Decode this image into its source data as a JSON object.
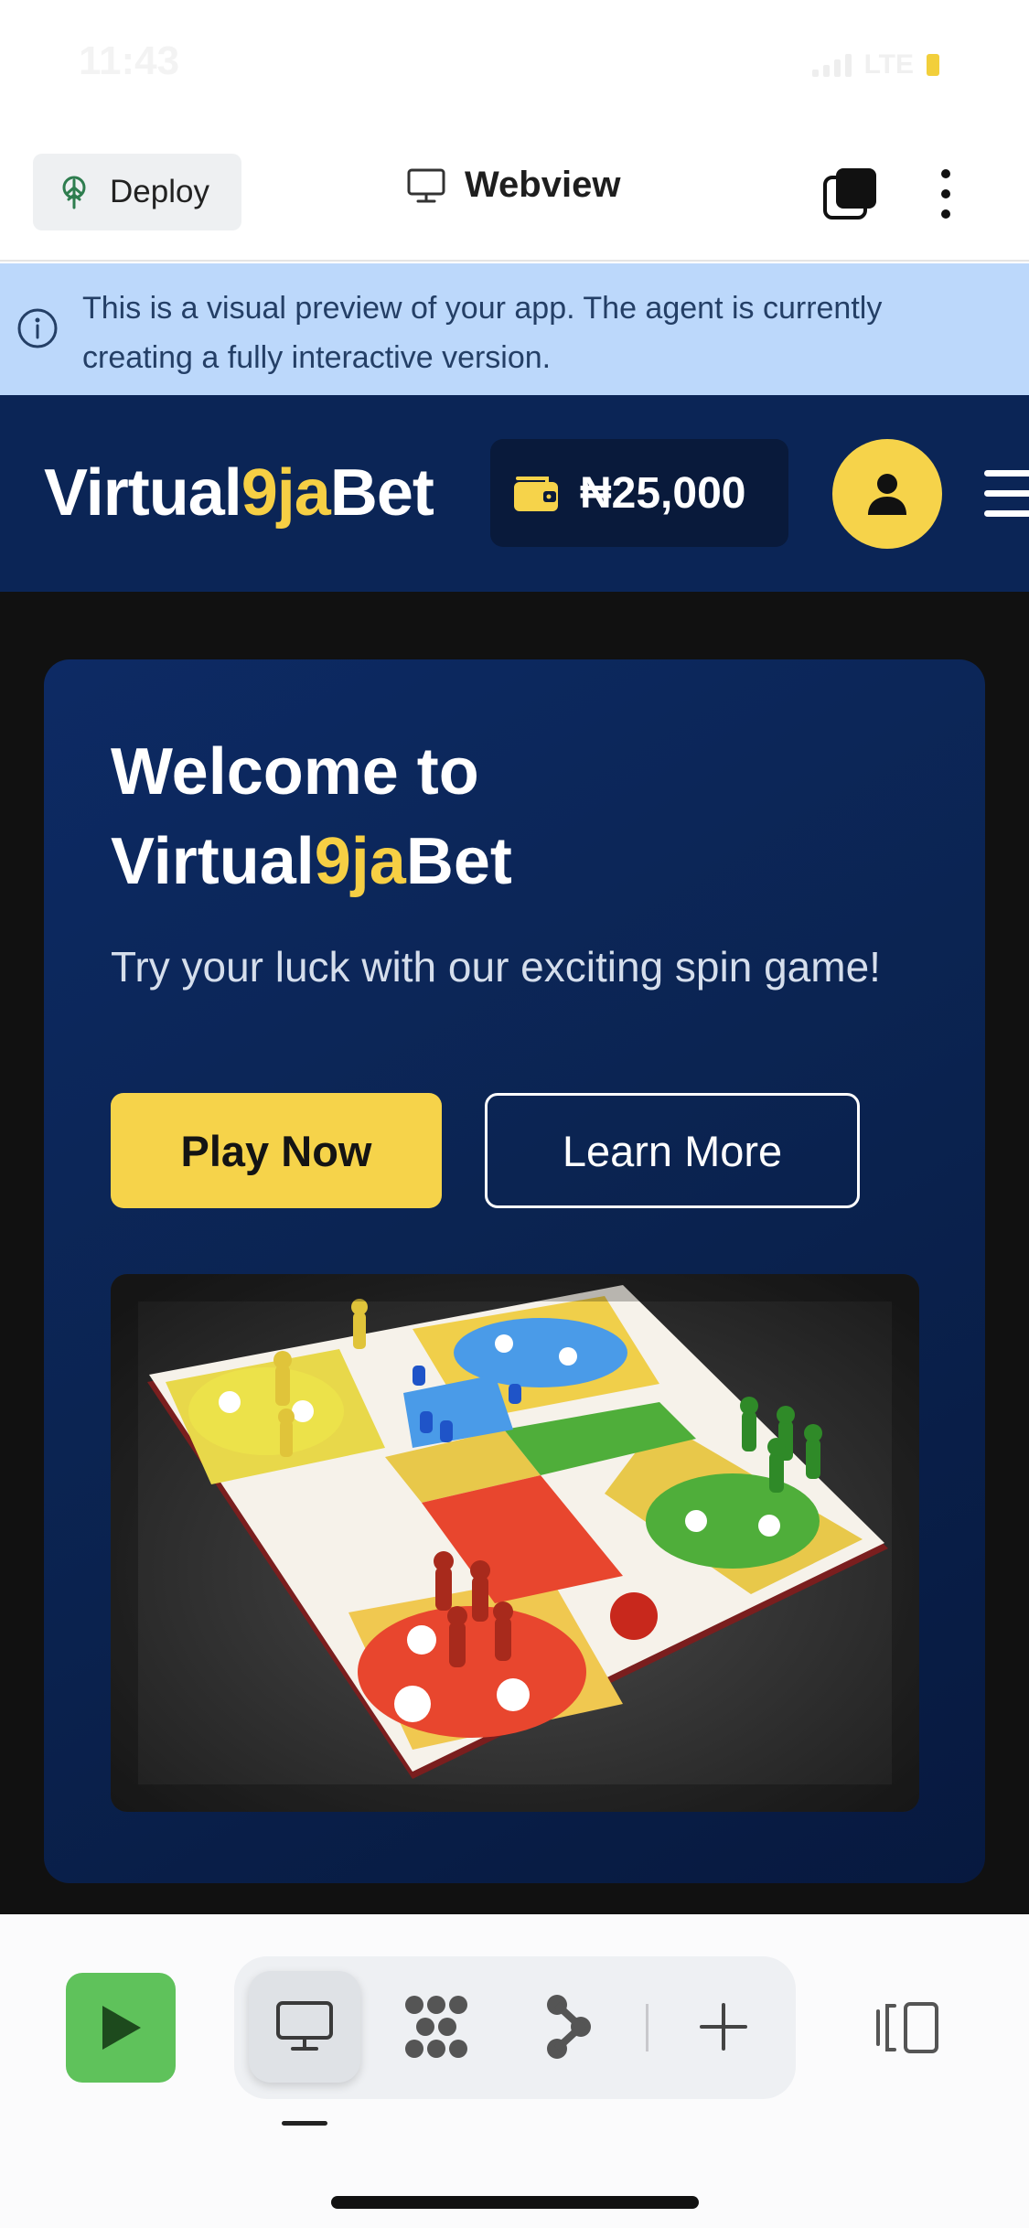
{
  "status_bar": {
    "time": "11:43",
    "network": "LTE"
  },
  "toolbar": {
    "deploy_label": "Deploy",
    "title": "Webview"
  },
  "banner": {
    "text": "This is a visual preview of your app. The agent is currently creating a fully interactive version."
  },
  "header": {
    "logo_part1": "Virtual",
    "logo_part2": "9ja",
    "logo_part3": "Bet",
    "wallet_amount": "₦25,000"
  },
  "hero": {
    "title_line1": "Welcome to",
    "title_part1": "Virtual",
    "title_part2": "9ja",
    "title_part3": "Bet",
    "subtitle": "Try your luck with our exciting spin game!",
    "play_label": "Play Now",
    "learn_label": "Learn More"
  },
  "colors": {
    "header_bg": "#0b2556",
    "accent": "#f6cf44",
    "banner_bg": "#bcd8fb",
    "run_green": "#5fc25b"
  },
  "icons": {
    "deploy": "deploy-tree-icon",
    "webview": "monitor-icon",
    "tabs": "tabs-icon",
    "more": "more-vertical-icon",
    "info": "info-icon",
    "wallet": "wallet-icon",
    "user": "user-icon",
    "menu": "hamburger-menu-icon",
    "run": "play-icon",
    "preview": "monitor-icon",
    "dots": "dots-grid-icon",
    "flow": "flow-icon",
    "add": "plus-icon",
    "split": "split-view-icon"
  }
}
